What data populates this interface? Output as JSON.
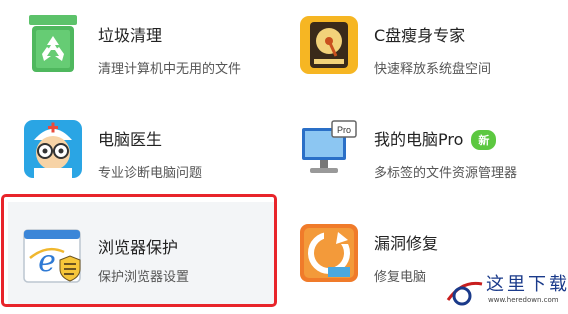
{
  "tools": [
    {
      "name": "垃圾清理",
      "desc": "清理计算机中无用的文件",
      "icon": "recycle-bin-icon"
    },
    {
      "name": "C盘瘦身专家",
      "desc": "快速释放系统盘空间",
      "icon": "hard-disk-icon"
    },
    {
      "name": "电脑医生",
      "desc": "专业诊断电脑问题",
      "icon": "doctor-icon"
    },
    {
      "name": "我的电脑Pro",
      "desc": "多标签的文件资源管理器",
      "badge": "新",
      "icon": "computer-pro-icon"
    },
    {
      "name": "浏览器保护",
      "desc": "保护浏览器设置",
      "icon": "browser-shield-icon"
    },
    {
      "name": "漏洞修复",
      "desc": "修复电脑",
      "icon": "repair-refresh-icon"
    }
  ],
  "highlighted_tool": "浏览器保护",
  "watermark": {
    "text": "这里下载",
    "url": "www.heredown.com"
  },
  "colors": {
    "highlight_border": "#e8242a",
    "badge_green": "#5cc840",
    "selected_bg": "#f3f5f7"
  }
}
